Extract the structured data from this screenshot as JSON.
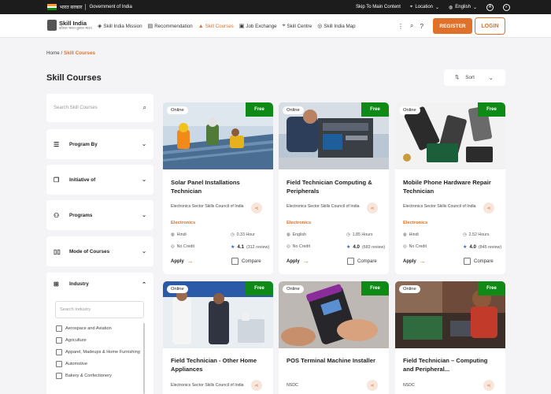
{
  "gov_bar": {
    "hindi": "भारत सरकार",
    "english": "Government of India",
    "skip": "Skip To Main Content",
    "location": "Location",
    "language": "English",
    "text_size": "A"
  },
  "nav": {
    "logo_title": "Skill India",
    "logo_subtitle": "कौशल भारत-कुशल भारत",
    "links": [
      "Skill India Mission",
      "Recommendation",
      "Skill Courses",
      "Job Exchange",
      "Skill Centre",
      "Skill India Map"
    ],
    "register": "REGISTER",
    "login": "LOGIN"
  },
  "breadcrumb": {
    "home": "Home",
    "sep": "/",
    "current": "Skill Courses"
  },
  "page_title": "Skill Courses",
  "sort_label": "Sort",
  "sidebar": {
    "search_placeholder": "Search Skill Courses",
    "filters": [
      "Program By",
      "Initiative of",
      "Programs",
      "Mode of Courses"
    ],
    "industry": {
      "label": "Industry",
      "search_placeholder": "Search Industry",
      "items": [
        "Aerospace and Aviation",
        "Agriculture",
        "Apparel, Madeups & Home Furnishing",
        "Automotive",
        "Bakery & Confectionery"
      ]
    }
  },
  "courses": [
    {
      "mode": "Online",
      "price": "Free",
      "title": "Solar Panel Installations Technician",
      "org": "Electronics Sector Skills Council of India",
      "sector": "Electronics",
      "language": "Hindi",
      "duration": "0.33 Hour",
      "credit": "No Credit",
      "rating": "4.1",
      "reviews": "(312 review)",
      "apply": "Apply",
      "compare": "Compare"
    },
    {
      "mode": "Online",
      "price": "Free",
      "title": "Field Technician Computing & Peripherals",
      "org": "Electronics Sector Skills Council of India",
      "sector": "Electronics",
      "language": "English",
      "duration": "1.85 Hours",
      "credit": "No Credit",
      "rating": "4.0",
      "reviews": "(683 review)",
      "apply": "Apply",
      "compare": "Compare"
    },
    {
      "mode": "Online",
      "price": "Free",
      "title": "Mobile Phone Hardware Repair Technician",
      "org": "Electronics Sector Skills Council of India",
      "sector": "Electronics",
      "language": "Hindi",
      "duration": "2.52 Hours",
      "credit": "No Credit",
      "rating": "4.0",
      "reviews": "(845 review)",
      "apply": "Apply",
      "compare": "Compare"
    },
    {
      "mode": "Online",
      "price": "Free",
      "title": "Field Technician - Other Home Appliances",
      "org": "Electronics Sector Skills Council of India"
    },
    {
      "mode": "Online",
      "price": "Free",
      "title": "POS Terminal Machine Installer",
      "org": "NSDC"
    },
    {
      "mode": "Online",
      "price": "Free",
      "title": "Field Technician – Computing and Peripheral...",
      "org": "NSDC"
    }
  ],
  "colors": {
    "accent": "#e0712b",
    "free_badge": "#0f8a16",
    "star": "#2b64c8"
  }
}
